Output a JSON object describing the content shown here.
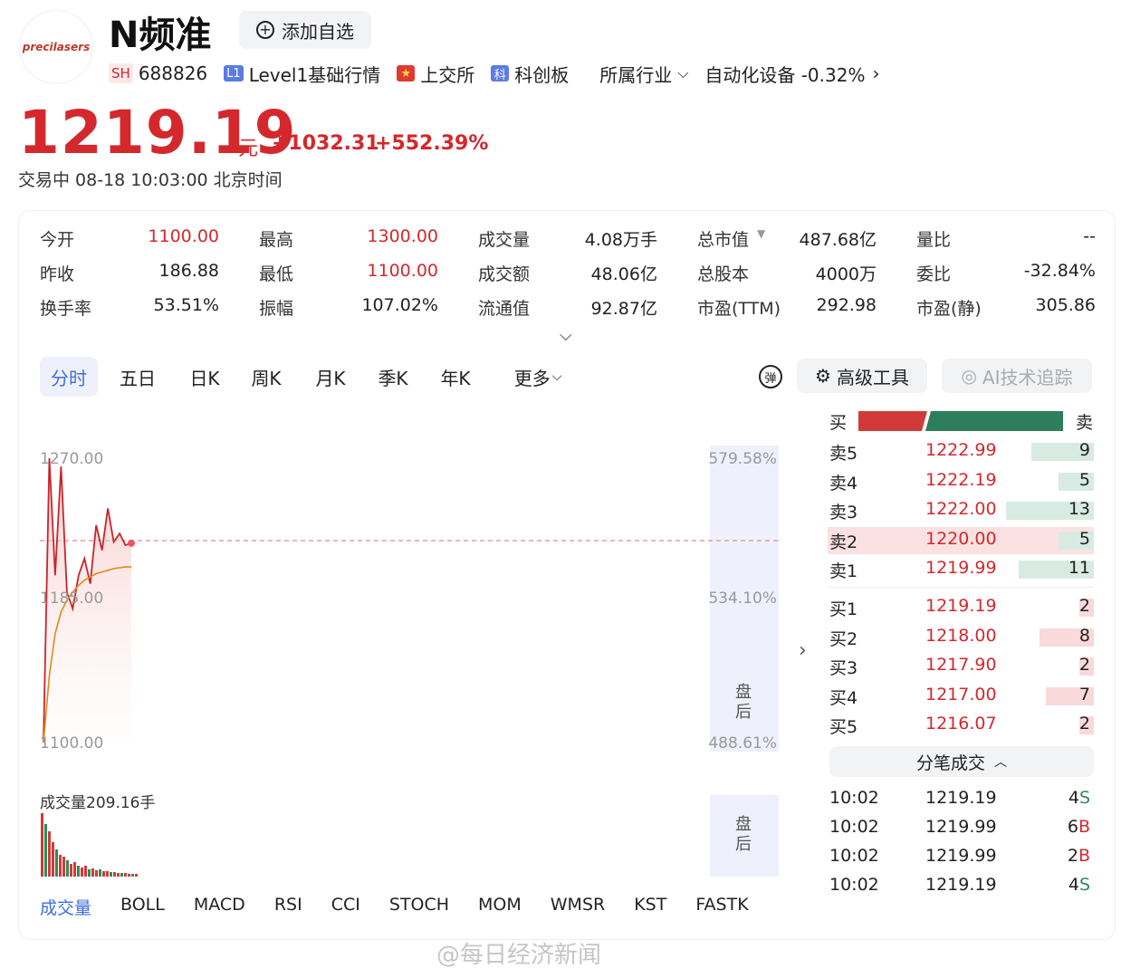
{
  "header": {
    "logo_text": "precilasers",
    "name": "N频准",
    "add_watch": "添加自选",
    "exchange_badge": "SH",
    "code": "688826",
    "level_badge": "L1",
    "level_text": "Level1基础行情",
    "market_text": "上交所",
    "board_badge": "科",
    "board_text": "科创板",
    "industry_label": "所属行业",
    "industry_value": "自动化设备 -0.32%"
  },
  "quote": {
    "price": "1219.19",
    "unit": "元",
    "change": "+1032.31",
    "change_pct": "+552.39%",
    "status": "交易中 08-18 10:03:00 北京时间"
  },
  "stats": [
    {
      "label": "今开",
      "value": "1100.00",
      "color": "red"
    },
    {
      "label": "最高",
      "value": "1300.00",
      "color": "red"
    },
    {
      "label": "成交量",
      "value": "4.08万手"
    },
    {
      "label": "总市值",
      "value": "487.68亿"
    },
    {
      "label": "量比",
      "value": "--"
    },
    {
      "label": "昨收",
      "value": "186.88"
    },
    {
      "label": "最低",
      "value": "1100.00",
      "color": "red"
    },
    {
      "label": "成交额",
      "value": "48.06亿"
    },
    {
      "label": "总股本",
      "value": "4000万"
    },
    {
      "label": "委比",
      "value": "-32.84%"
    },
    {
      "label": "换手率",
      "value": "53.51%"
    },
    {
      "label": "振幅",
      "value": "107.02%"
    },
    {
      "label": "流通值",
      "value": "92.87亿"
    },
    {
      "label": "市盈(TTM)",
      "value": "292.98"
    },
    {
      "label": "市盈(静)",
      "value": "305.86"
    }
  ],
  "tabs": [
    "分时",
    "五日",
    "日K",
    "周K",
    "月K",
    "季K",
    "年K",
    "更多"
  ],
  "tools": {
    "advanced": "高级工具",
    "ai": "AI技术追踪"
  },
  "chart": {
    "y_top": "1270.00",
    "y_mid": "1185.00",
    "y_bot": "1100.00",
    "pct_top": "579.58%",
    "pct_mid": "534.10%",
    "pct_bot": "488.61%",
    "after_hours": "盘后",
    "volume_label": "成交量209.16手"
  },
  "chart_data": {
    "type": "line",
    "title": "",
    "ylim": [
      1100,
      1270
    ],
    "series": [
      {
        "name": "",
        "values": [
          1100,
          1270,
          1200,
          1265,
          1190,
          1180,
          1200,
          1210,
          1195,
          1230,
          1215,
          1240,
          1220,
          1225,
          1218,
          1219.19
        ]
      },
      {
        "name": "",
        "values": [
          1100,
          1140,
          1165,
          1178,
          1185,
          1190,
          1194,
          1197,
          1199,
          1201,
          1202,
          1203,
          1204,
          1204.5,
          1205,
          1205
        ]
      }
    ]
  },
  "orderbook": {
    "buy_label": "买",
    "sell_label": "卖",
    "asks": [
      {
        "l": "卖5",
        "p": "1222.99",
        "v": "9",
        "w": 0.3
      },
      {
        "l": "卖4",
        "p": "1222.19",
        "v": "5",
        "w": 0.17
      },
      {
        "l": "卖3",
        "p": "1222.00",
        "v": "13",
        "w": 0.42
      },
      {
        "l": "卖2",
        "p": "1220.00",
        "v": "5",
        "w": 0.17
      },
      {
        "l": "卖1",
        "p": "1219.99",
        "v": "11",
        "w": 0.36
      }
    ],
    "bids": [
      {
        "l": "买1",
        "p": "1219.19",
        "v": "2",
        "w": 0.07
      },
      {
        "l": "买2",
        "p": "1218.00",
        "v": "8",
        "w": 0.26
      },
      {
        "l": "买3",
        "p": "1217.90",
        "v": "2",
        "w": 0.07
      },
      {
        "l": "买4",
        "p": "1217.00",
        "v": "7",
        "w": 0.23
      },
      {
        "l": "买5",
        "p": "1216.07",
        "v": "2",
        "w": 0.07
      }
    ]
  },
  "trades_title": "分笔成交",
  "trades": [
    {
      "t": "10:02",
      "p": "1219.19",
      "v": "4",
      "s": "S"
    },
    {
      "t": "10:02",
      "p": "1219.99",
      "v": "6",
      "s": "B"
    },
    {
      "t": "10:02",
      "p": "1219.99",
      "v": "2",
      "s": "B"
    },
    {
      "t": "10:02",
      "p": "1219.19",
      "v": "4",
      "s": "S"
    }
  ],
  "indicators": [
    "成交量",
    "BOLL",
    "MACD",
    "RSI",
    "CCI",
    "STOCH",
    "MOM",
    "WMSR",
    "KST",
    "FASTK"
  ],
  "watermark": "@每日经济新闻"
}
